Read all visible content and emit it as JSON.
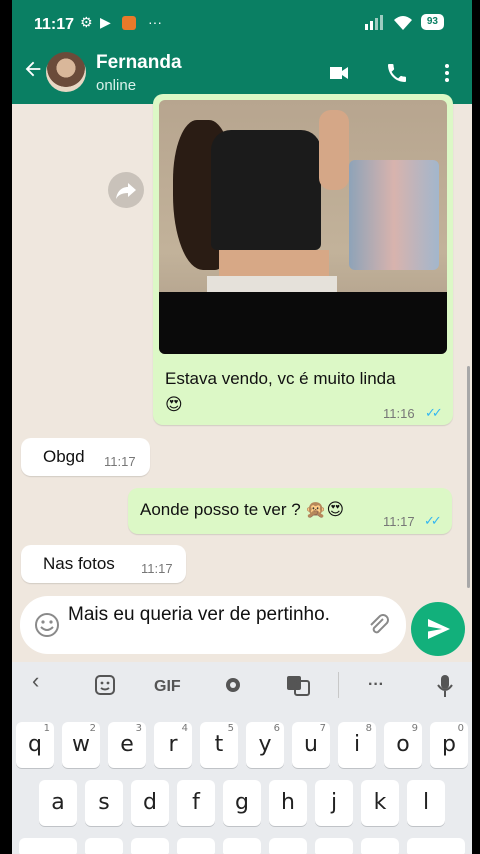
{
  "status_bar": {
    "time": "11:17",
    "battery": "93"
  },
  "header": {
    "contact_name": "Fernanda",
    "contact_status": "online"
  },
  "messages": [
    {
      "direction": "out",
      "text": "Estava vendo, vc é muito linda 😍",
      "time": "11:16",
      "ticks": "✓✓"
    },
    {
      "direction": "in",
      "text": "Obgd",
      "time": "11:17"
    },
    {
      "direction": "out",
      "text": "Aonde posso te ver ? 🙊😍",
      "time": "11:17",
      "ticks": "✓✓"
    },
    {
      "direction": "in",
      "text": "Nas fotos",
      "time": "11:17"
    }
  ],
  "composer": {
    "text": "Mais eu queria ver de pertinho."
  },
  "keyboard": {
    "tools": [
      "‹",
      "GIF",
      "···"
    ],
    "row1": [
      {
        "k": "q",
        "h": "1"
      },
      {
        "k": "w",
        "h": "2"
      },
      {
        "k": "e",
        "h": "3"
      },
      {
        "k": "r",
        "h": "4"
      },
      {
        "k": "t",
        "h": "5"
      },
      {
        "k": "y",
        "h": "6"
      },
      {
        "k": "u",
        "h": "7"
      },
      {
        "k": "i",
        "h": "8"
      },
      {
        "k": "o",
        "h": "9"
      },
      {
        "k": "p",
        "h": "0"
      }
    ],
    "row2": [
      "a",
      "s",
      "d",
      "f",
      "g",
      "h",
      "j",
      "k",
      "l"
    ]
  },
  "colors": {
    "header": "#0a7f63",
    "outgoing_bubble": "#dcf8c6",
    "send_button": "#12b07b",
    "chat_bg": "#efe7de"
  },
  "icons": [
    "settings-gear-icon",
    "video-recorder-icon",
    "app-notification-icon",
    "more-dots-icon",
    "signal-icon",
    "wifi-icon",
    "back-arrow-icon",
    "video-call-icon",
    "phone-icon",
    "menu-dots-icon",
    "forward-icon",
    "emoji-icon",
    "attach-icon",
    "send-icon",
    "sticker-icon",
    "settings-icon",
    "translate-icon",
    "microphone-icon"
  ]
}
